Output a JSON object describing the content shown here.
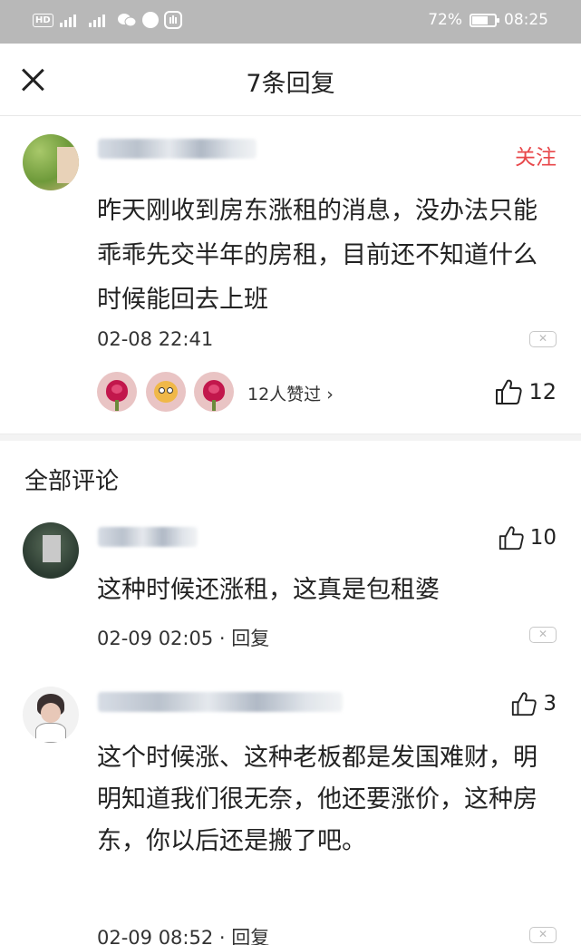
{
  "status_bar": {
    "network_badge": "HD",
    "battery_percent": "72%",
    "battery_level": 0.72,
    "time": "08:25"
  },
  "header": {
    "title": "7条回复"
  },
  "post": {
    "follow_label": "关注",
    "text": "昨天刚收到房东涨租的消息，没办法只能乖乖先交半年的房租，目前还不知道什么时候能回去上班",
    "timestamp": "02-08 22:41",
    "likes_summary": "12人赞过 ›",
    "like_count": "12"
  },
  "section_title": "全部评论",
  "comments": [
    {
      "text": "这种时候还涨租，这真是包租婆",
      "timestamp": "02-09 02:05",
      "reply_label": "回复",
      "like_count": "10"
    },
    {
      "text": "这个时候涨、这种老板都是发国难财，明明知道我们很无奈，他还要涨价，这种房东，你以后还是搬了吧。",
      "timestamp": "02-09 08:52",
      "reply_label": "回复",
      "like_count": "3"
    }
  ],
  "icons": {
    "close": "close-icon",
    "like": "thumbs-up-icon",
    "report": "report-close-icon"
  },
  "colors": {
    "follow": "#e8474a",
    "status_bar": "#b8b8b8"
  }
}
